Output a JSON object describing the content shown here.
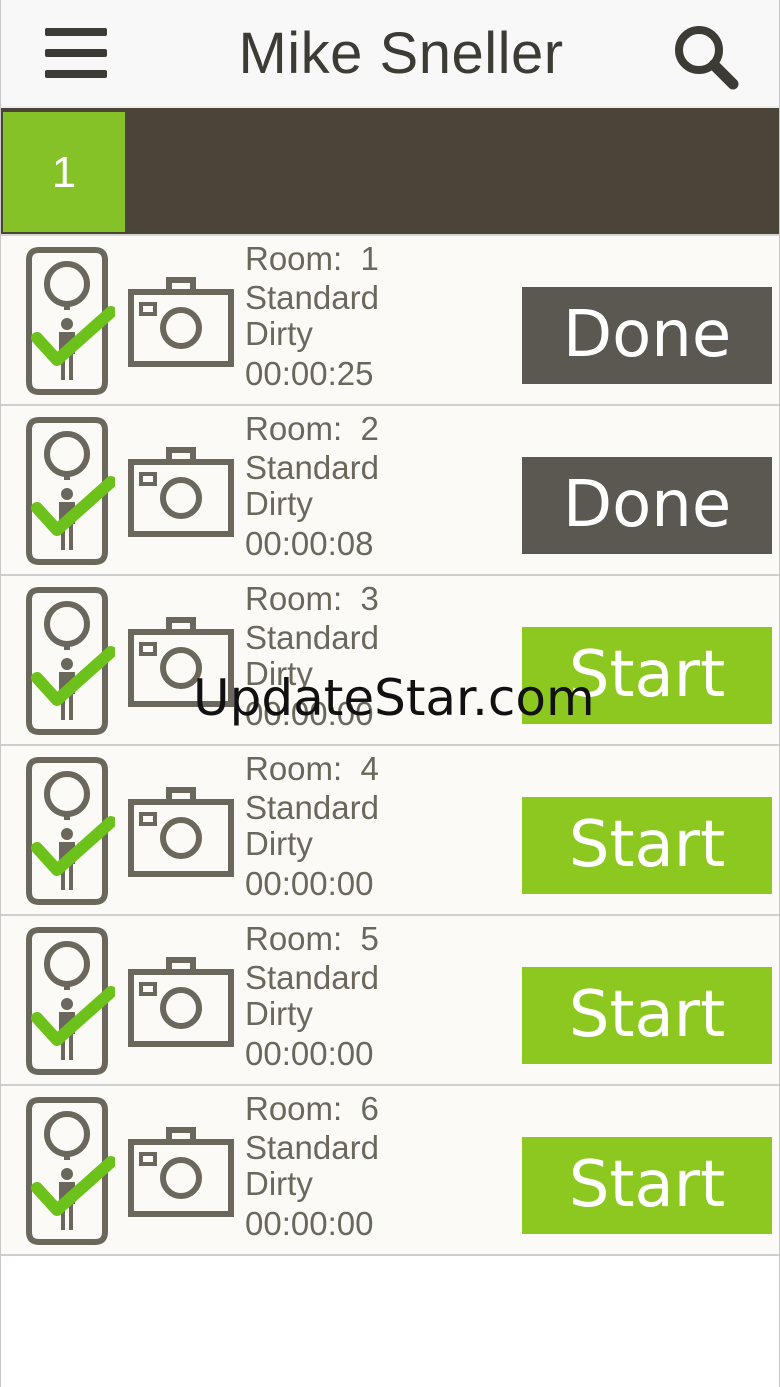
{
  "header": {
    "title": "Mike Sneller"
  },
  "icons": {
    "menu": "hamburger-menu-icon",
    "search": "search-icon",
    "tag": "door-hanger-check-icon",
    "camera": "camera-icon"
  },
  "tabs": [
    {
      "label": "1",
      "active": true
    }
  ],
  "room_label": "Room:",
  "rooms": [
    {
      "number": "1",
      "type": "Standard",
      "status": "Dirty",
      "timer": "00:00:25",
      "action": "Done"
    },
    {
      "number": "2",
      "type": "Standard",
      "status": "Dirty",
      "timer": "00:00:08",
      "action": "Done"
    },
    {
      "number": "3",
      "type": "Standard",
      "status": "Dirty",
      "timer": "00:00:00",
      "action": "Start"
    },
    {
      "number": "4",
      "type": "Standard",
      "status": "Dirty",
      "timer": "00:00:00",
      "action": "Start"
    },
    {
      "number": "5",
      "type": "Standard",
      "status": "Dirty",
      "timer": "00:00:00",
      "action": "Start"
    },
    {
      "number": "6",
      "type": "Standard",
      "status": "Dirty",
      "timer": "00:00:00",
      "action": "Start"
    }
  ],
  "colors": {
    "accent_green": "#8cc820",
    "done_gray": "#5b5852",
    "tabbar_brown": "#4a4538",
    "text_dark": "#3d3b35"
  },
  "watermark": "UpdateStar.com"
}
